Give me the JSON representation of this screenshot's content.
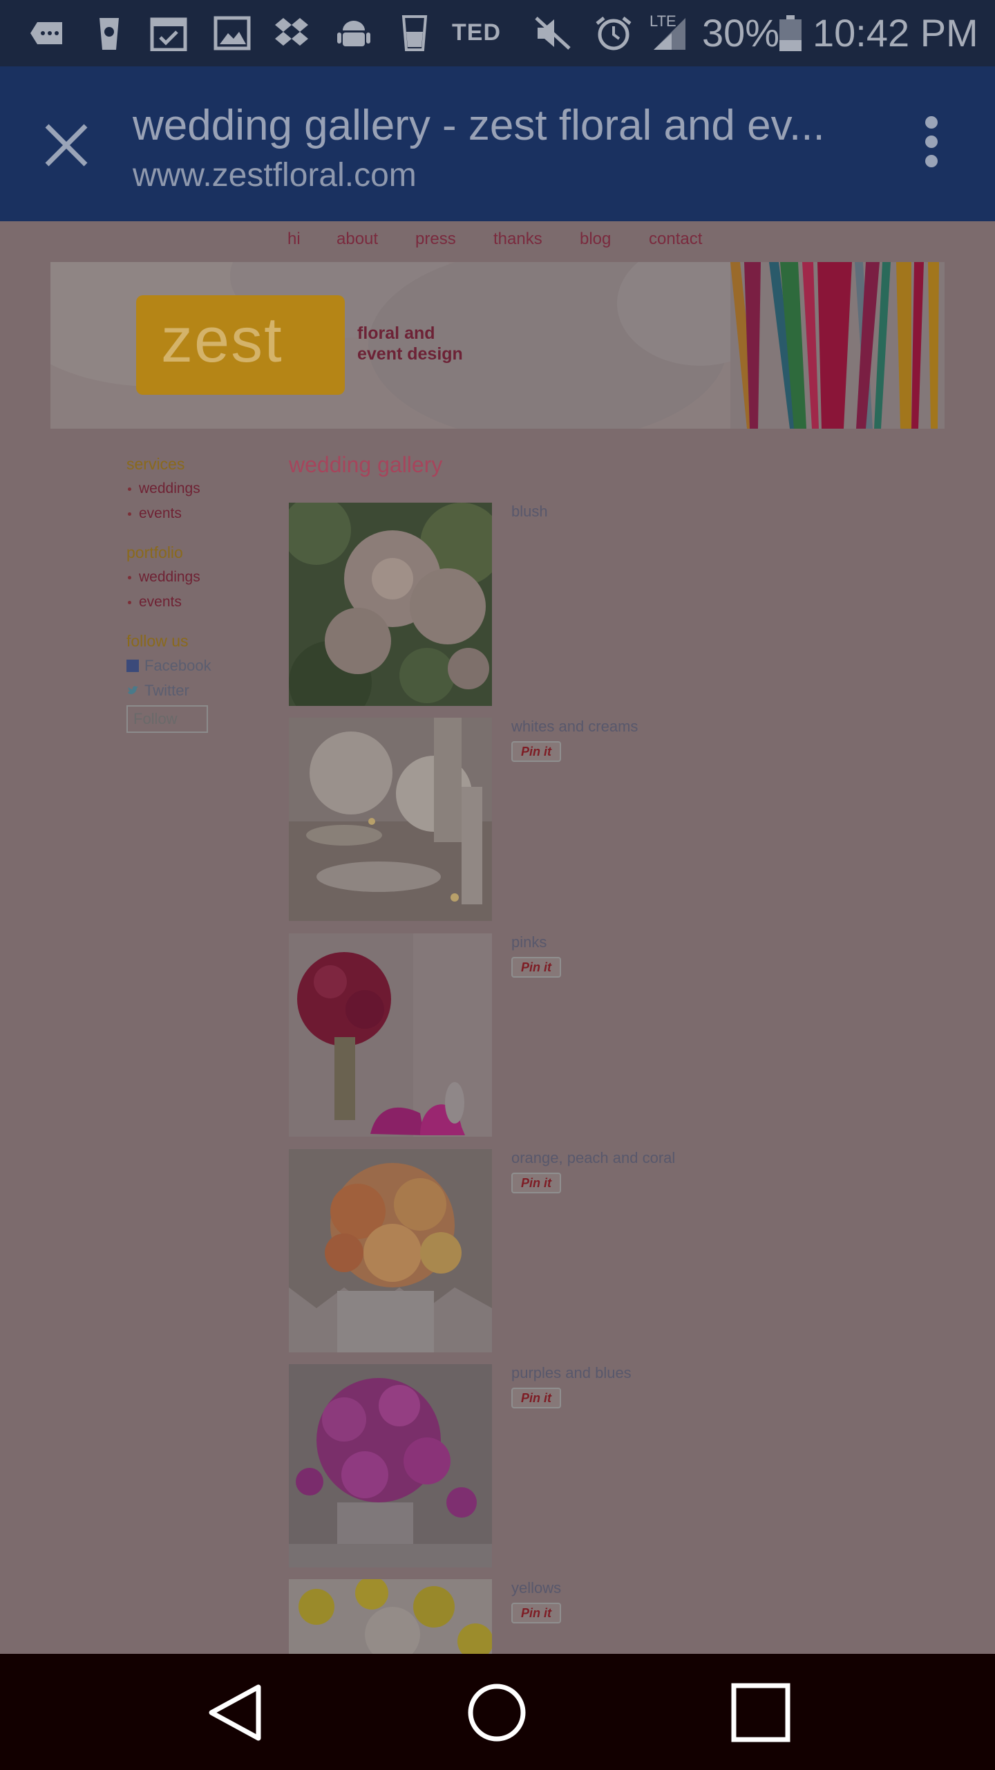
{
  "status_bar": {
    "battery": "30%",
    "time": "10:42 PM",
    "network": "LTE",
    "ted": "TED",
    "icons": [
      "notification-icon",
      "coffee-icon",
      "calendar-icon",
      "gallery-icon",
      "dropbox-icon",
      "android-icon",
      "cup-icon",
      "mute-icon",
      "alarm-icon",
      "signal-icon",
      "battery-icon"
    ]
  },
  "toolbar": {
    "title": "wedding gallery - zest floral and ev...",
    "url": "www.zestfloral.com"
  },
  "site": {
    "nav": [
      "hi",
      "about",
      "press",
      "thanks",
      "blog",
      "contact"
    ],
    "logo": "zest",
    "tagline_1": "floral and",
    "tagline_2": "event design",
    "sidebar": {
      "services": "services",
      "services_items": [
        "weddings",
        "events"
      ],
      "portfolio": "portfolio",
      "portfolio_items": [
        "weddings",
        "events"
      ],
      "follow": "follow us",
      "facebook": "Facebook",
      "twitter": "Twitter",
      "follow_button": "Follow"
    },
    "main_title": "wedding gallery",
    "pin_label": "Pin it",
    "gallery": [
      {
        "label": "blush"
      },
      {
        "label": "whites and creams"
      },
      {
        "label": "pinks"
      },
      {
        "label": "orange, peach and coral"
      },
      {
        "label": "purples and blues"
      },
      {
        "label": "yellows"
      }
    ]
  },
  "colors": {
    "status_bar": "#1b2740",
    "toolbar": "#1a3160",
    "page_bg": "#7c6b6d",
    "nav_bar": "#120000",
    "accent": "#a6455c"
  }
}
